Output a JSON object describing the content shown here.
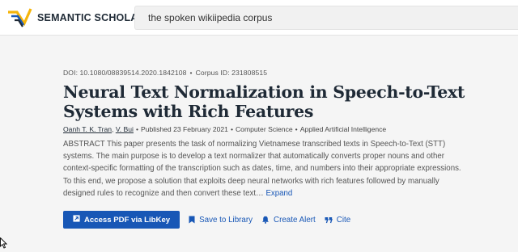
{
  "header": {
    "logo_text": "SEMANTIC SCHOLAR",
    "search_value": "the spoken wikiipedia corpus"
  },
  "paper": {
    "doi": "DOI: 10.1080/08839514.2020.1842108",
    "corpus_id": "Corpus ID: 231808515",
    "title": "Neural Text Normalization in Speech-to-Text Systems with Rich Features",
    "authors": [
      "Oanh T. K. Tran",
      "V. Bui"
    ],
    "published": "Published 23 February 2021",
    "fields": [
      "Computer Science",
      "Applied Artificial Intelligence"
    ],
    "abstract": "ABSTRACT This paper presents the task of normalizing Vietnamese transcribed texts in Speech-to-Text (STT) systems. The main purpose is to develop a text normalizer that automatically converts proper nouns and other context-specific formatting of the transcription such as dates, time, and numbers into their appropriate expressions. To this end, we propose a solution that exploits deep neural networks with rich features followed by manually designed rules to recognize and then convert these text…",
    "expand_label": "Expand"
  },
  "actions": {
    "access_pdf": "Access PDF via LibKey",
    "save": "Save to Library",
    "alert": "Create Alert",
    "cite": "Cite"
  },
  "colors": {
    "accent": "#1857b6",
    "title": "#1f2a36",
    "logo_yellow": "#f5b50b",
    "background": "#f5f5f5"
  }
}
